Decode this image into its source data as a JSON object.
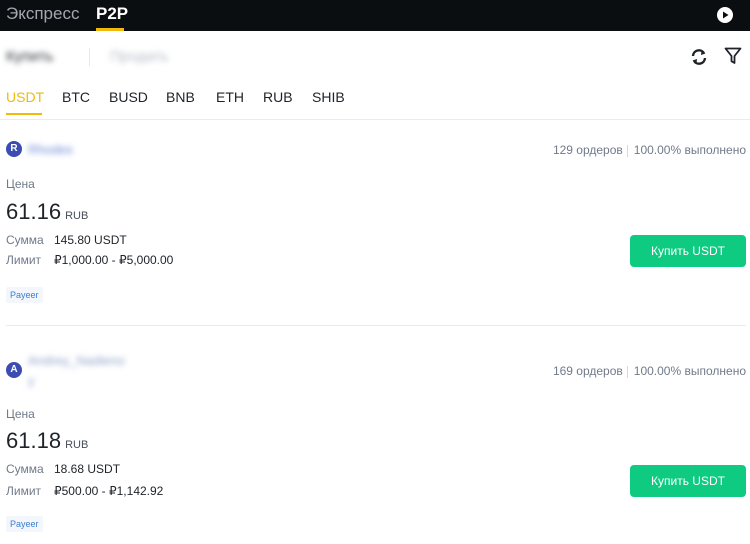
{
  "top_tabs": {
    "express": "Экспресс",
    "p2p": "P2P"
  },
  "trade_side": {
    "buy": "Купить",
    "sell": "Продать"
  },
  "coins": [
    "USDT",
    "BTC",
    "BUSD",
    "BNB",
    "ETH",
    "RUB",
    "SHIB"
  ],
  "active_coin": "USDT",
  "colors": {
    "accent": "#f0b90b",
    "buy": "#0ecb81",
    "topbar": "#0b0e11",
    "link": "#3b7ed0"
  },
  "ads": [
    {
      "avatar": "R",
      "merchant": "Rhodes",
      "orders": "129 ордеров",
      "completion": "100.00% выполнено",
      "price_label": "Цена",
      "price": "61.16",
      "currency": "RUB",
      "amount_label": "Сумма",
      "amount": "145.80 USDT",
      "limit_label": "Лимит",
      "limit": "₽1,000.00 - ₽5,000.00",
      "payment": "Payeer",
      "buy_label": "Купить USDT"
    },
    {
      "avatar": "A",
      "merchant": "Andrey_Nadieno",
      "merchant_line2": "y",
      "orders": "169 ордеров",
      "completion": "100.00% выполнено",
      "price_label": "Цена",
      "price": "61.18",
      "currency": "RUB",
      "amount_label": "Сумма",
      "amount": "18.68 USDT",
      "limit_label": "Лимит",
      "limit": "₽500.00 - ₽1,142.92",
      "payment": "Payeer",
      "buy_label": "Купить USDT"
    }
  ]
}
